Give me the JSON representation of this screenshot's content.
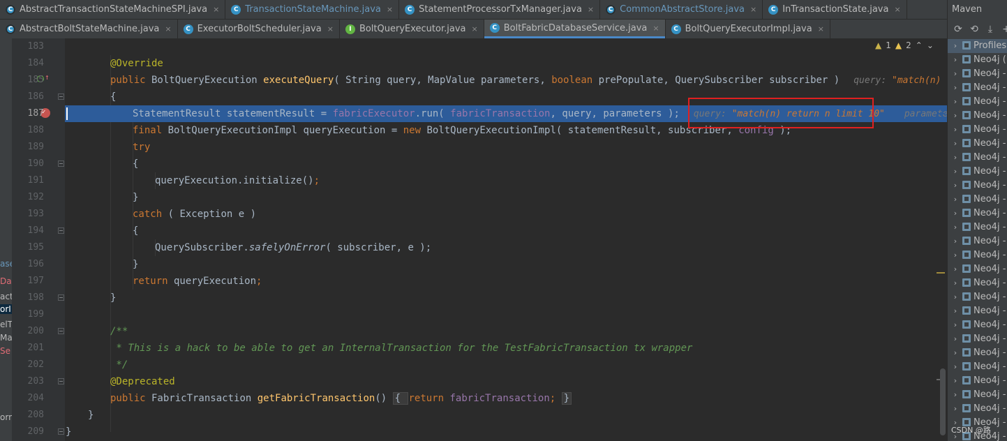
{
  "tabs_row1": [
    {
      "label": "AbstractTransactionStateMachineSPI.java",
      "icon": "abstract-class-icon",
      "modified": false
    },
    {
      "label": "TransactionStateMachine.java",
      "icon": "class-icon",
      "modified": true
    },
    {
      "label": "StatementProcessorTxManager.java",
      "icon": "class-icon",
      "modified": false
    },
    {
      "label": "CommonAbstractStore.java",
      "icon": "abstract-class-icon",
      "modified": true
    },
    {
      "label": "InTransactionState.java",
      "icon": "class-icon",
      "modified": false
    }
  ],
  "tabs_row2": [
    {
      "label": "AbstractBoltStateMachine.java",
      "icon": "abstract-class-icon",
      "active": false
    },
    {
      "label": "ExecutorBoltScheduler.java",
      "icon": "class-icon",
      "active": false
    },
    {
      "label": "BoltQueryExecutor.java",
      "icon": "interface-icon",
      "active": false
    },
    {
      "label": "BoltFabricDatabaseService.java",
      "icon": "class-icon",
      "active": true
    },
    {
      "label": "BoltQueryExecutorImpl.java",
      "icon": "class-icon",
      "active": false
    }
  ],
  "close_glyph": "×",
  "left_strip": [
    {
      "text": "ase",
      "style": "blue"
    },
    {
      "text": "Da",
      "style": "err"
    },
    {
      "text": "acti",
      "style": "normal"
    },
    {
      "text": "orI",
      "style": "sel"
    },
    {
      "text": "elT",
      "style": "normal"
    },
    {
      "text": "Ma",
      "style": "normal"
    },
    {
      "text": "Se",
      "style": "err"
    },
    {
      "text": "orm",
      "style": "normal"
    }
  ],
  "line_numbers": [
    "183",
    "184",
    "185",
    "186",
    "187",
    "188",
    "189",
    "190",
    "191",
    "192",
    "193",
    "194",
    "195",
    "196",
    "197",
    "198",
    "199",
    "200",
    "201",
    "202",
    "203",
    "204",
    "208",
    "209"
  ],
  "current_line": "187",
  "code": {
    "l184": "@Override",
    "l185": {
      "kw": "public",
      "type": " BoltQueryExecution ",
      "fn": "executeQuery",
      "rest": "( String query, MapValue parameters, ",
      "kw2": "boolean",
      "rest2": " prePopulate, QuerySubscriber subscriber )",
      "hint_label": "query: ",
      "hint_value": "\"match(n) return"
    },
    "l186": "{",
    "l187": {
      "a": "StatementResult statementResult = ",
      "f1": "fabricExecutor",
      "b": ".run( ",
      "f2": "fabricTransaction",
      "c": ", query, parameters );",
      "hint_label": "query: ",
      "hint_value": "\"match(n) return n limit 10\"",
      "hint2": "parameters:"
    },
    "l188": {
      "kw": "final",
      "a": " BoltQueryExecutionImpl queryExecution = ",
      "kw2": "new",
      "b": " BoltQueryExecutionImpl( statementResult, subscriber, ",
      "f": "config",
      "c": " );"
    },
    "l189": "try",
    "l190": "{",
    "l191": {
      "a": "queryExecution.initialize()",
      "semi": ";"
    },
    "l192": "}",
    "l193": {
      "kw": "catch",
      "a": " ( Exception e )"
    },
    "l194": "{",
    "l195": {
      "a": "QuerySubscriber.",
      "it": "safelyOnError",
      "b": "( subscriber, e );"
    },
    "l196": "}",
    "l197": {
      "kw": "return",
      "a": " queryExecution",
      "semi": ";"
    },
    "l198": "}",
    "l200": "/**",
    "l201": " * This is a hack to be able to get an InternalTransaction for the TestFabricTransaction tx wrapper",
    "l202": " */",
    "l203": "@Deprecated",
    "l204": {
      "kw": "public",
      "a": " FabricTransaction ",
      "fn": "getFabricTransaction",
      "b": "() ",
      "box_open": "{ ",
      "kw2": "return",
      "sp": " ",
      "f": "fabricTransaction",
      "semi": "; ",
      "box_close": "}"
    },
    "l208": "}",
    "l209": "}"
  },
  "indicators": {
    "warn1_count": "1",
    "warn2_count": "2",
    "up": "⌃",
    "down": "⌄"
  },
  "maven": {
    "title": "Maven",
    "profiles": "Profiles",
    "module_label": "Neo4j -",
    "first_module_label": "Neo4j (",
    "module_count": 28
  },
  "watermark": "CSDN @路",
  "colors": {
    "accent": "#4a88c7",
    "highlight": "#2d5c9a",
    "annotation_box": "#e02020"
  }
}
